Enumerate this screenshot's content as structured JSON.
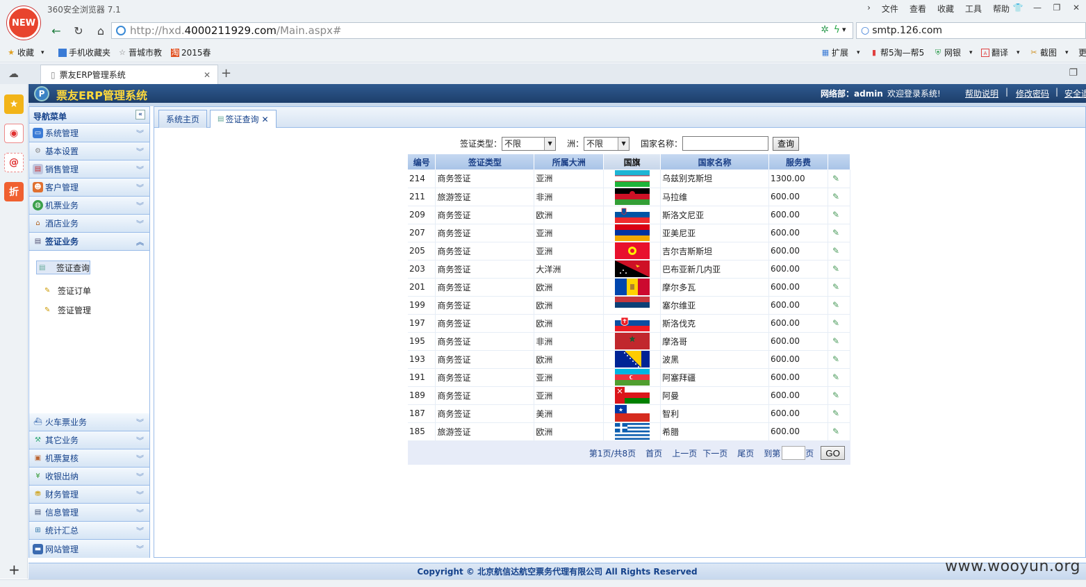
{
  "browser": {
    "logo_text": "NEW",
    "title": "360安全浏览器 7.1",
    "menu": [
      "文件",
      "查看",
      "收藏",
      "工具",
      "帮助"
    ],
    "url_prefix": "http://hxd.",
    "url_host": "4000211929.com",
    "url_path": "/Main.aspx#",
    "search_text": "smtp.126.com",
    "bookmarks": [
      "收藏",
      "手机收藏夹",
      "晋城市教",
      "2015春"
    ],
    "toolbar_right": [
      "扩展",
      "帮5淘—帮5",
      "网银",
      "翻译",
      "截图",
      "更"
    ],
    "tab_title": "票友ERP管理系统"
  },
  "colors": {
    "header": "#1d3e6b",
    "title": "#ffd93a",
    "accent": "#15428b"
  },
  "app": {
    "title": "票友ERP管理系统",
    "user": "网络部：admin",
    "welcome": "欢迎登录系统!",
    "links": [
      "帮助说明",
      "修改密码",
      "安全退"
    ],
    "separator": "|"
  },
  "nav": {
    "header": "导航菜单",
    "collapse_glyph": "«",
    "items_top": [
      {
        "label": "系统管理",
        "icon": "monitor-icon"
      },
      {
        "label": "基本设置",
        "icon": "gear-icon"
      },
      {
        "label": "销售管理",
        "icon": "chart-icon"
      },
      {
        "label": "客户管理",
        "icon": "customer-icon"
      },
      {
        "label": "机票业务",
        "icon": "globe-icon"
      },
      {
        "label": "酒店业务",
        "icon": "hotel-icon"
      },
      {
        "label": "签证业务",
        "icon": "visa-icon"
      }
    ],
    "visa_sub": [
      "签证查询",
      "签证订单",
      "签证管理"
    ],
    "items_bottom": [
      {
        "label": "火车票业务",
        "icon": "train-icon"
      },
      {
        "label": "其它业务",
        "icon": "tools-icon"
      },
      {
        "label": "机票复核",
        "icon": "review-icon"
      },
      {
        "label": "收银出纳",
        "icon": "yen-icon"
      },
      {
        "label": "财务管理",
        "icon": "finance-icon"
      },
      {
        "label": "信息管理",
        "icon": "info-icon"
      },
      {
        "label": "统计汇总",
        "icon": "stats-icon"
      },
      {
        "label": "网站管理",
        "icon": "website-icon"
      }
    ]
  },
  "content_tabs": [
    "系统主页",
    "签证查询"
  ],
  "query": {
    "type_label": "签证类型：",
    "type_value": "不限",
    "continent_label": "洲：",
    "continent_value": "不限",
    "name_label": "国家名称：",
    "name_value": "",
    "button": "查询"
  },
  "table": {
    "headers": [
      "编号",
      "签证类型",
      "所属大洲",
      "国旗",
      "国家名称",
      "服务费",
      ""
    ],
    "rows": [
      {
        "id": "214",
        "type": "商务签证",
        "continent": "亚洲",
        "flag": "uzbekistan",
        "country": "乌兹别克斯坦",
        "fee": "1300.00"
      },
      {
        "id": "211",
        "type": "旅游签证",
        "continent": "非洲",
        "flag": "malawi",
        "country": "马拉维",
        "fee": "600.00"
      },
      {
        "id": "209",
        "type": "商务签证",
        "continent": "欧洲",
        "flag": "slovenia",
        "country": "斯洛文尼亚",
        "fee": "600.00"
      },
      {
        "id": "207",
        "type": "商务签证",
        "continent": "亚洲",
        "flag": "armenia",
        "country": "亚美尼亚",
        "fee": "600.00"
      },
      {
        "id": "205",
        "type": "商务签证",
        "continent": "亚洲",
        "flag": "kyrgyzstan",
        "country": "吉尔吉斯斯坦",
        "fee": "600.00"
      },
      {
        "id": "203",
        "type": "商务签证",
        "continent": "大洋洲",
        "flag": "png",
        "country": "巴布亚新几内亚",
        "fee": "600.00"
      },
      {
        "id": "201",
        "type": "商务签证",
        "continent": "欧洲",
        "flag": "moldova",
        "country": "摩尔多瓦",
        "fee": "600.00"
      },
      {
        "id": "199",
        "type": "商务签证",
        "continent": "欧洲",
        "flag": "serbia",
        "country": "塞尔维亚",
        "fee": "600.00"
      },
      {
        "id": "197",
        "type": "商务签证",
        "continent": "欧洲",
        "flag": "slovakia",
        "country": "斯洛伐克",
        "fee": "600.00"
      },
      {
        "id": "195",
        "type": "商务签证",
        "continent": "非洲",
        "flag": "morocco",
        "country": "摩洛哥",
        "fee": "600.00"
      },
      {
        "id": "193",
        "type": "商务签证",
        "continent": "欧洲",
        "flag": "bosnia",
        "country": "波黑",
        "fee": "600.00"
      },
      {
        "id": "191",
        "type": "商务签证",
        "continent": "亚洲",
        "flag": "azerbaijan",
        "country": "阿塞拜疆",
        "fee": "600.00"
      },
      {
        "id": "189",
        "type": "商务签证",
        "continent": "亚洲",
        "flag": "oman",
        "country": "阿曼",
        "fee": "600.00"
      },
      {
        "id": "187",
        "type": "商务签证",
        "continent": "美洲",
        "flag": "chile",
        "country": "智利",
        "fee": "600.00"
      },
      {
        "id": "185",
        "type": "旅游签证",
        "continent": "欧洲",
        "flag": "greece",
        "country": "希腊",
        "fee": "600.00"
      }
    ]
  },
  "pager": {
    "info": "第1页/共8页",
    "first": "首页",
    "prev": "上一页",
    "next": "下一页",
    "last": "尾页",
    "goto_label": "到第",
    "page_unit": "页",
    "go": "GO"
  },
  "footer": "Copyright © 北京航信达航空票务代理有限公司 All Rights Reserved",
  "watermark": "www.wooyun.org"
}
